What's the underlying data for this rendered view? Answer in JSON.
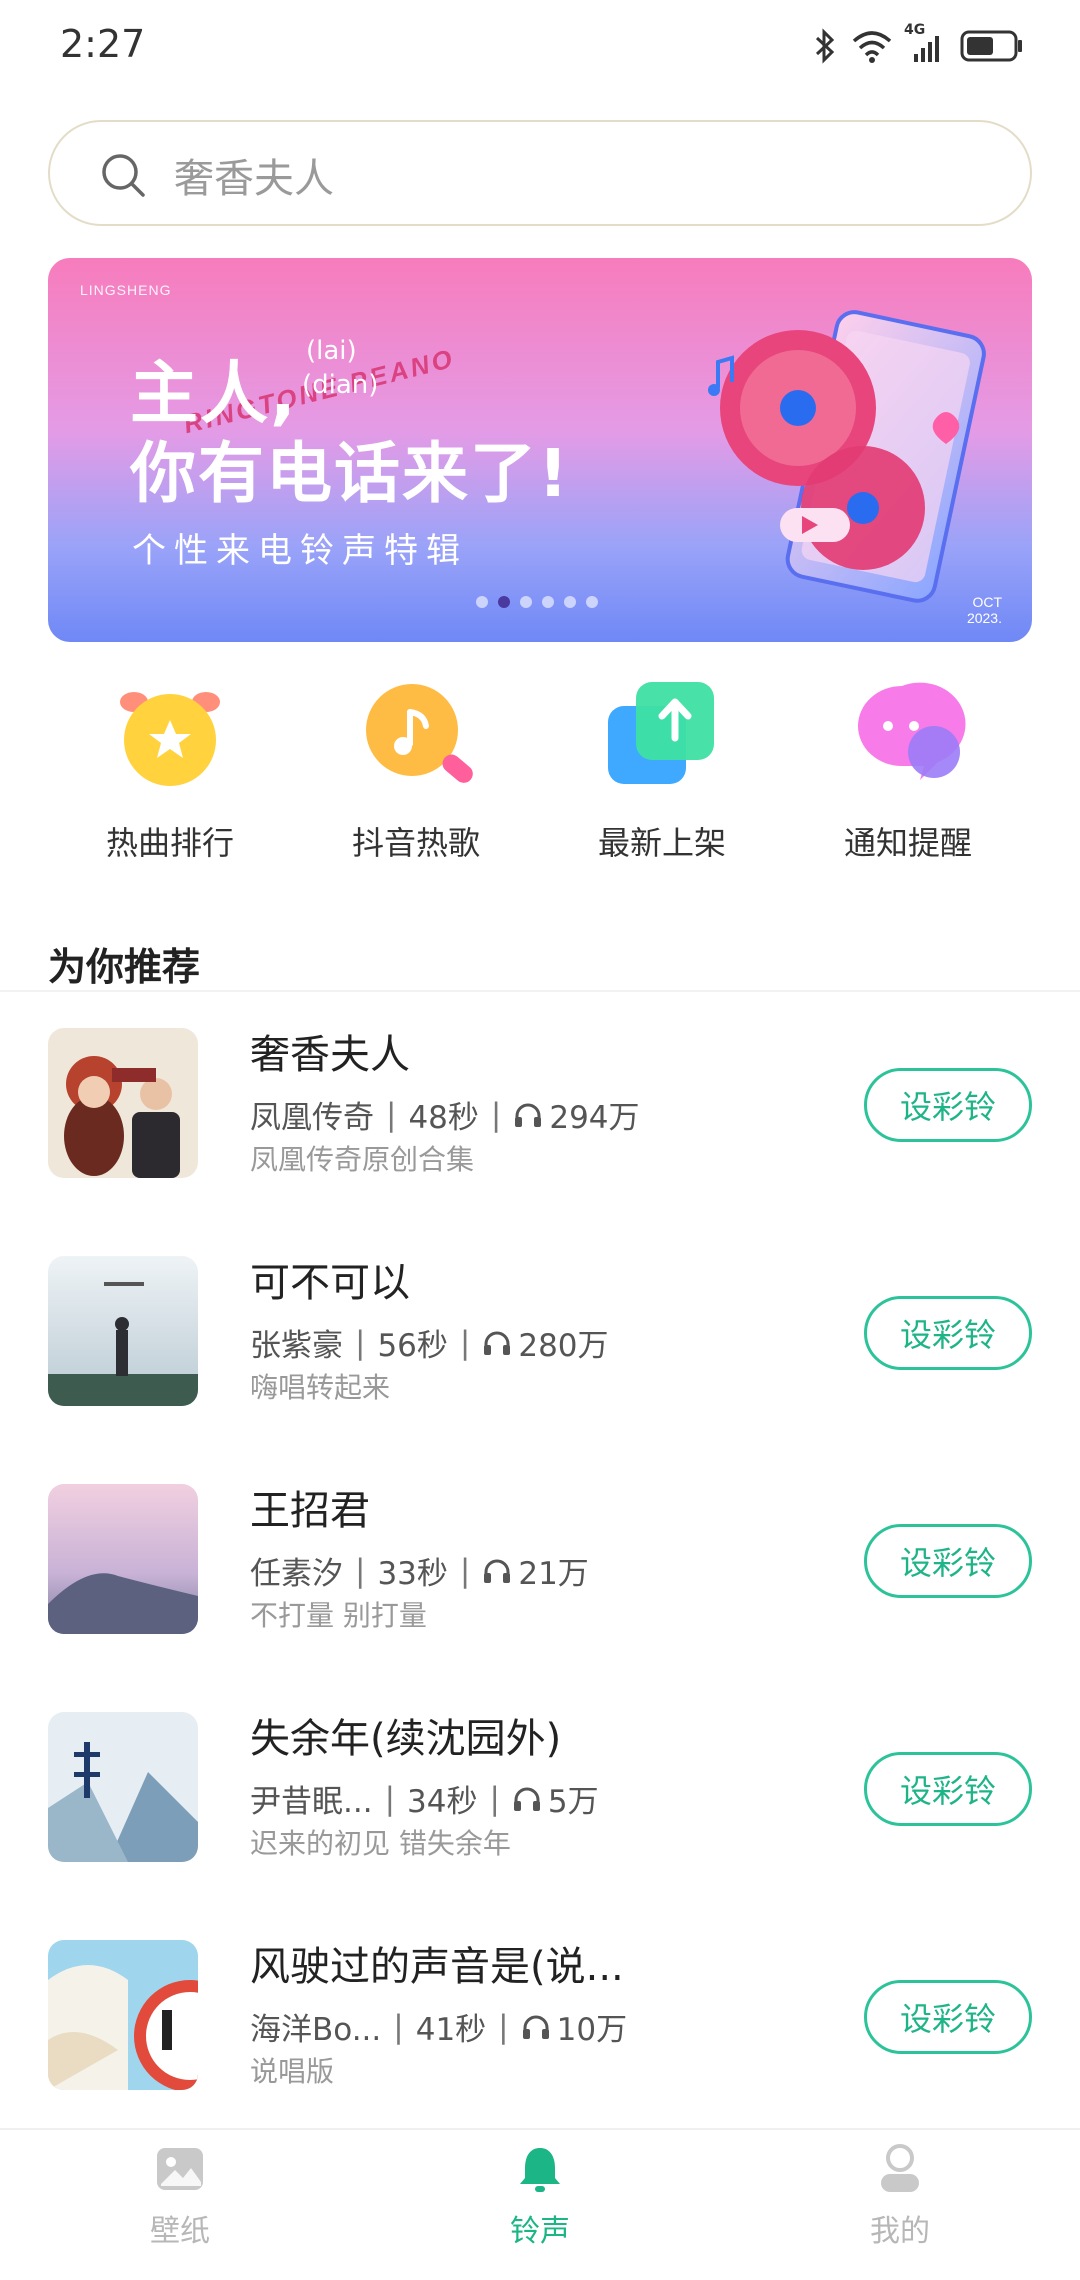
{
  "status_bar": {
    "time": "2:27",
    "network": "4G"
  },
  "search": {
    "placeholder": "奢香夫人"
  },
  "banner": {
    "brand": "LINGSHENG",
    "title_line1": "主人,",
    "annot_lai": "(lai)",
    "annot_dian": "(dian)",
    "title_line2": "你有电话来了!",
    "subtitle": "个性来电铃声特辑",
    "deco_text": "RINGTONE PEANO",
    "date_line1": "OCT",
    "date_line2": "2023.",
    "dots_total": 6,
    "dots_active": 1
  },
  "categories": [
    {
      "label": "热曲排行",
      "icon": "star-clock-icon"
    },
    {
      "label": "抖音热歌",
      "icon": "music-note-icon"
    },
    {
      "label": "最新上架",
      "icon": "upload-arrow-icon"
    },
    {
      "label": "通知提醒",
      "icon": "chat-bubble-icon"
    }
  ],
  "section": {
    "title": "为你推荐"
  },
  "songs": [
    {
      "title": "奢香夫人",
      "artist": "凤凰传奇",
      "duration": "48秒",
      "plays": "294万",
      "subtitle": "凤凰传奇原创合集",
      "button": "设彩铃"
    },
    {
      "title": "可不可以",
      "artist": "张紫豪",
      "duration": "56秒",
      "plays": "280万",
      "subtitle": "嗨唱转起来",
      "button": "设彩铃"
    },
    {
      "title": "王招君",
      "artist": "任素汐",
      "duration": "33秒",
      "plays": "21万",
      "subtitle": "不打量 别打量",
      "button": "设彩铃"
    },
    {
      "title": "失余年(续沈园外)",
      "artist": "尹昔眠...",
      "duration": "34秒",
      "plays": "5万",
      "subtitle": "迟来的初见 错失余年",
      "button": "设彩铃"
    },
    {
      "title": "风驶过的声音是(说...",
      "artist": "海洋Bo...",
      "duration": "41秒",
      "plays": "10万",
      "subtitle": "说唱版",
      "button": "设彩铃"
    }
  ],
  "bottom_nav": [
    {
      "label": "壁纸",
      "icon": "image-icon",
      "active": false
    },
    {
      "label": "铃声",
      "icon": "bell-icon",
      "active": true
    },
    {
      "label": "我的",
      "icon": "person-icon",
      "active": false
    }
  ],
  "colors": {
    "accent": "#1cb585",
    "button_border": "#2cc39a"
  }
}
